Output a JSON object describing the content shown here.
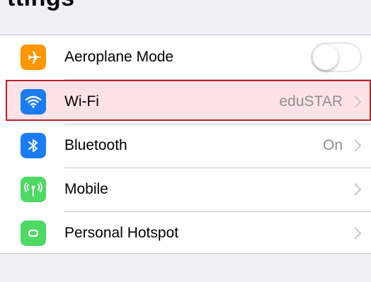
{
  "colors": {
    "background": "#efeff4",
    "airplane": "#ff9500",
    "wifi": "#1b7cf5",
    "bluetooth": "#1b7cf5",
    "mobile": "#4cd964",
    "hotspot": "#4cd964",
    "highlight_border": "#c0202e"
  },
  "header": {
    "partial_title": "ttings"
  },
  "rows": [
    {
      "icon": "airplane-icon",
      "label": "Aeroplane Mode",
      "toggle_on": false
    },
    {
      "icon": "wifi-icon",
      "label": "Wi-Fi",
      "value": "eduSTAR"
    },
    {
      "icon": "bluetooth-icon",
      "label": "Bluetooth",
      "value": "On"
    },
    {
      "icon": "antenna-icon",
      "label": "Mobile"
    },
    {
      "icon": "hotspot-icon",
      "label": "Personal Hotspot"
    }
  ]
}
